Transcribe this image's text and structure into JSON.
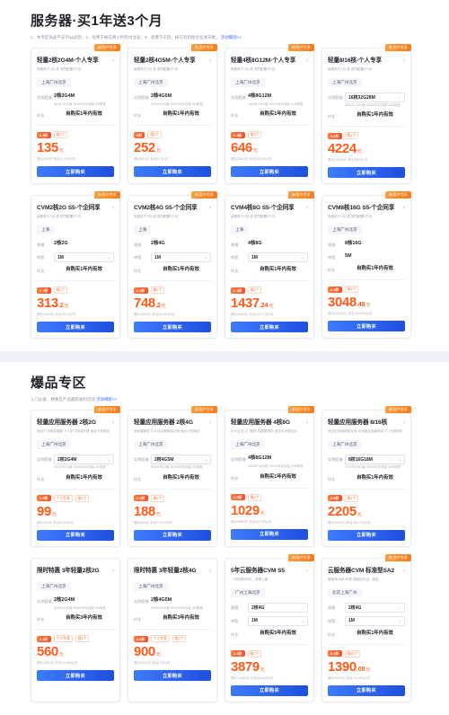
{
  "sections": [
    {
      "id": "server-promo",
      "title": "服务器·买1年送3个月",
      "subtitle": "1、本专区商品不支持ąą退款；2、续费于帐信两小时的付注发；3、续费于次后，帐在资到组合发放天数。",
      "subtitle_link": "活动细则>>",
      "rows": [
        {
          "cards": [
            {
              "ribbon": "新用户专享",
              "title": "轻量2核2G4M-个人专享",
              "desc": "续费低于1月 或 送同配置3个月",
              "region": "上海广州北京",
              "specs": [
                {
                  "label": "实例套餐",
                  "value": "2核2G4M",
                  "type": "text",
                  "note": "50GB SSD盘 3000GB月流量 4M带宽"
                },
                {
                  "label": "时长",
                  "value": "自购买1年内有效",
                  "type": "center"
                }
              ],
              "badges": [
                "2.3折",
                "限1个"
              ],
              "price": "135",
              "price_dec": "",
              "price_unit": "元",
              "price_old": "原价600元 折合11.25元/月",
              "buy": "立即购买"
            },
            {
              "ribbon": "新用户专享",
              "title": "轻量2核4G5M-个人专享",
              "desc": "续费低于1月 或 送同配置3个月",
              "region": "上海广州北京",
              "specs": [
                {
                  "label": "实例套餐",
                  "value": "2核4G5M",
                  "type": "text",
                  "note": "60GB SSD盘 5000GB月流量 5M带宽"
                },
                {
                  "label": "时长",
                  "value": "自购买1年内有效",
                  "type": "center"
                }
              ],
              "badges": [
                "3折",
                "限1个"
              ],
              "price": "252",
              "price_dec": "",
              "price_unit": "元",
              "price_old": "原价840元 折合21元/月",
              "buy": "立即购买"
            },
            {
              "ribbon": "新用户专享",
              "title": "轻量4核8G12M-个人专享",
              "desc": "续费低于1月 或 送同配置3个月",
              "region": "上海广州北京",
              "specs": [
                {
                  "label": "实例套餐",
                  "value": "4核8G12M",
                  "type": "text",
                  "note": "180GB SSD盘 2000GB月流量 12M带宽"
                },
                {
                  "label": "时长",
                  "value": "自购买1年内有效",
                  "type": "center"
                }
              ],
              "badges": [
                "2.3折",
                "限1个"
              ],
              "price": "646",
              "price_dec": "",
              "price_unit": "元",
              "price_old": "原价2880元 折合53.83元/月",
              "buy": "立即购买"
            },
            {
              "ribbon": "新用户专享",
              "title": "轻量8/16核-个人专享",
              "desc": "续费低于1月 或 送同配置3个月",
              "region": "上海广州北京",
              "specs": [
                {
                  "label": "实例套餐",
                  "value": "16核32G28M",
                  "type": "select",
                  "note": "380GB SSD盘 6000GB月流量 28M带宽"
                },
                {
                  "label": "时长",
                  "value": "自购买1年内有效",
                  "type": "center"
                }
              ],
              "badges": [
                "3.2折",
                "限1个"
              ],
              "price": "4224",
              "price_dec": "",
              "price_unit": "元",
              "price_old": "原价13200元 折合352元/月",
              "buy": "立即购买"
            }
          ]
        },
        {
          "cards": [
            {
              "ribbon": "新用户专享",
              "title": "CVM2核2G S5-个企同享",
              "desc": "续费低于1月 或 送同配置3个月",
              "region": "上海",
              "specs": [
                {
                  "label": "规格",
                  "value": "2核2G",
                  "type": "text"
                },
                {
                  "label": "带宽",
                  "value": "1M",
                  "type": "select"
                },
                {
                  "label": "时长",
                  "value": "自购买1年内有效",
                  "type": "center"
                }
              ],
              "badges": [
                "2.3折",
                "限1个"
              ],
              "price": "313",
              "price_dec": ".2",
              "price_unit": "元",
              "price_old": "原价1360元 折合26.1元/月",
              "buy": "立即购买"
            },
            {
              "ribbon": "新用户专享",
              "title": "CVM2核4G S5-个企同享",
              "desc": "续费低于1月 或 送同配置3个月",
              "region": "上海",
              "specs": [
                {
                  "label": "规格",
                  "value": "2核4G",
                  "type": "text"
                },
                {
                  "label": "带宽",
                  "value": "1M",
                  "type": "select"
                },
                {
                  "label": "时长",
                  "value": "自购买1年内有效",
                  "type": "center"
                }
              ],
              "badges": [
                "2.3折",
                "限1个"
              ],
              "price": "748",
              "price_dec": ".2",
              "price_unit": "元",
              "price_old": "原价3600元 折合62.35元/月",
              "buy": "立即购买"
            },
            {
              "ribbon": "新用户专享",
              "title": "CVM4核8G S5-个企同享",
              "desc": "续费低于1月 或 送同配置3个月",
              "region": "上海",
              "specs": [
                {
                  "label": "规格",
                  "value": "4核8G",
                  "type": "text"
                },
                {
                  "label": "带宽",
                  "value": "1M",
                  "type": "select"
                },
                {
                  "label": "时长",
                  "value": "自购买1年内有效",
                  "type": "center"
                }
              ],
              "badges": [
                "2.3折",
                "限1个"
              ],
              "price": "1437",
              "price_dec": ".24",
              "price_unit": "元",
              "price_old": "原价6480元 折合119.77元/月",
              "buy": "立即购买"
            },
            {
              "ribbon": "新用户专享",
              "title": "CVM8核16G S5-个企同享",
              "desc": "续费低于1月 或 送同配置3个月",
              "region": "上海广州北京",
              "specs": [
                {
                  "label": "规格",
                  "value": "8核16G",
                  "type": "text"
                },
                {
                  "label": "带宽",
                  "value": "5M",
                  "type": "text"
                },
                {
                  "label": "时长",
                  "value": "自购买1年内有效",
                  "type": "center"
                }
              ],
              "badges": [
                "2.3折",
                "限1个"
              ],
              "price": "3048",
              "price_dec": ".48",
              "price_unit": "元",
              "price_old": "原价13252元 折合254.04元/月",
              "buy": "立即购买"
            }
          ]
        }
      ]
    },
    {
      "id": "hot-products",
      "title": "爆品专区",
      "subtitle": "入门必备，精致云产品最新福利活动",
      "subtitle_link": "活动细则>>",
      "rows": [
        {
          "cards": [
            {
              "ribbon": "新用户专享",
              "title": "轻量应用服务器 2核2G",
              "desc": "适合个人网站搭建 个人学习测试环境 适合小型网站",
              "region": "上海广州北京",
              "specs": [
                {
                  "label": "实例套餐",
                  "value": "2核2G4M",
                  "type": "select",
                  "note": "50GB SSD盘 3000GB月流量 4M带宽"
                },
                {
                  "label": "时长",
                  "value": "自购买1年内有效",
                  "type": "center"
                }
              ],
              "badges": [
                "1.6折",
                "个人专享",
                "限1个"
              ],
              "price": "99",
              "price_dec": "",
              "price_unit": "元",
              "price_old": "原价600元 折合8.25元/月",
              "buy": "立即购买"
            },
            {
              "ribbon": "新用户专享",
              "title": "轻量应用服务器 2核4G",
              "desc": "适合建网站 中小站点和网站应用 适合小型网站",
              "region": "上海广州北京",
              "specs": [
                {
                  "label": "实例套餐",
                  "value": "2核4G5M",
                  "type": "select",
                  "note": "60GB SSD盘 5000GB月流量 5M带宽"
                },
                {
                  "label": "时长",
                  "value": "自购买1年内有效",
                  "type": "center"
                }
              ],
              "badges": [
                "2.2折",
                "限1个"
              ],
              "price": "188",
              "price_dec": "",
              "price_unit": "元",
              "price_old": "原价840元 折合15.67元/月",
              "buy": "立即购买"
            },
            {
              "ribbon": "新用户专享",
              "title": "轻量应用服务器 4核8G",
              "desc": "中小企业入门选择 性能更强效 适合中大型站点",
              "region": "上海广州北京",
              "specs": [
                {
                  "label": "实例套餐",
                  "value": "4核8G12M",
                  "type": "text",
                  "note": "180GB SSD盘 2000GB月流量 12M带宽"
                },
                {
                  "label": "时长",
                  "value": "自购买1年内有效",
                  "type": "center"
                }
              ],
              "badges": [
                "3.5折",
                "限1个"
              ],
              "price": "1029",
              "price_dec": "",
              "price_unit": "元",
              "price_old": "原价2880元 折合85.75元/月",
              "buy": "立即购买"
            },
            {
              "ribbon": "新用户专享",
              "title": "轻量应用服务器 8/16核",
              "desc": "适合企业级网站应用 大流量企业级网站 777大型网站",
              "region": "上海广州北京",
              "specs": [
                {
                  "label": "实例套餐",
                  "value": "8核16G18M",
                  "type": "select",
                  "note": "270GB SSD盘 3500GB月流量 18M带宽"
                },
                {
                  "label": "时长",
                  "value": "自购买1年内有效",
                  "type": "center"
                }
              ],
              "badges": [
                "3.5折",
                "限1个"
              ],
              "price": "2205",
              "price_dec": "",
              "price_unit": "元",
              "price_old": "原价6300元 折合183.75元/月",
              "buy": "立即购买"
            }
          ]
        },
        {
          "cards": [
            {
              "ribbon": "",
              "title": "限时特惠 3年轻量2核2G",
              "desc": "",
              "region": "上海广州北京",
              "specs": [
                {
                  "label": "实例套餐",
                  "value": "2核2G4M",
                  "type": "text",
                  "note": "50GB SSD盘 3000GB月流量 4M带宽"
                },
                {
                  "label": "时长",
                  "value": "自购买3年内有效",
                  "type": "center"
                }
              ],
              "badges": [
                "3.1折",
                "个人专享",
                "限1个"
              ],
              "price": "560",
              "price_dec": "",
              "price_unit": "元",
              "price_old": "原价1800元 折合15.56元/月",
              "buy": "立即购买"
            },
            {
              "ribbon": "",
              "title": "限时特惠 3年轻量2核4G",
              "desc": "",
              "region": "上海广州北京",
              "specs": [
                {
                  "label": "实例套餐",
                  "value": "2核4G5M",
                  "type": "text",
                  "note": "60GB SSD盘 5000GB月流量 5M带宽"
                },
                {
                  "label": "时长",
                  "value": "自购买3年内有效",
                  "type": "center"
                }
              ],
              "badges": [
                "3.6折",
                "个人专享",
                "限1个"
              ],
              "price": "900",
              "price_dec": "",
              "price_unit": "元",
              "price_old": "原价2520元 折合25元/月",
              "buy": "立即购买"
            },
            {
              "ribbon": "新用户专享",
              "title": "5年云服务器CVM S5",
              "desc": "一次性购买5年，再享上新",
              "region": "广州上海北京",
              "specs": [
                {
                  "label": "规格",
                  "value": "2核4G",
                  "type": "select"
                },
                {
                  "label": "带宽",
                  "value": "1M",
                  "type": "select"
                },
                {
                  "label": "时长",
                  "value": "自购买5年内有效",
                  "type": "center"
                }
              ],
              "badges": [
                "3.4折",
                "限1个"
              ],
              "price": "3879",
              "price_dec": "",
              "price_unit": "元",
              "price_old": "原价11400元 折合64.65元/月",
              "buy": "立即购买"
            },
            {
              "ribbon": "新用户专享",
              "title": "云服务器CVM 标准型SA2",
              "desc": "覆盖海 AMD优质 超高性价比、稳定",
              "region": "北京上海广州",
              "specs": [
                {
                  "label": "规格",
                  "value": "2核4G",
                  "type": "select"
                },
                {
                  "label": "带宽",
                  "value": "1M",
                  "type": "select"
                },
                {
                  "label": "时长",
                  "value": "自购买1年内有效",
                  "type": "center"
                }
              ],
              "badges": [
                "5.4折",
                "限50个"
              ],
              "price": "1390",
              "price_dec": ".08",
              "price_unit": "元",
              "price_old": "原价2490元 折合115.84元/月",
              "buy": "立即购买"
            }
          ]
        }
      ]
    }
  ]
}
